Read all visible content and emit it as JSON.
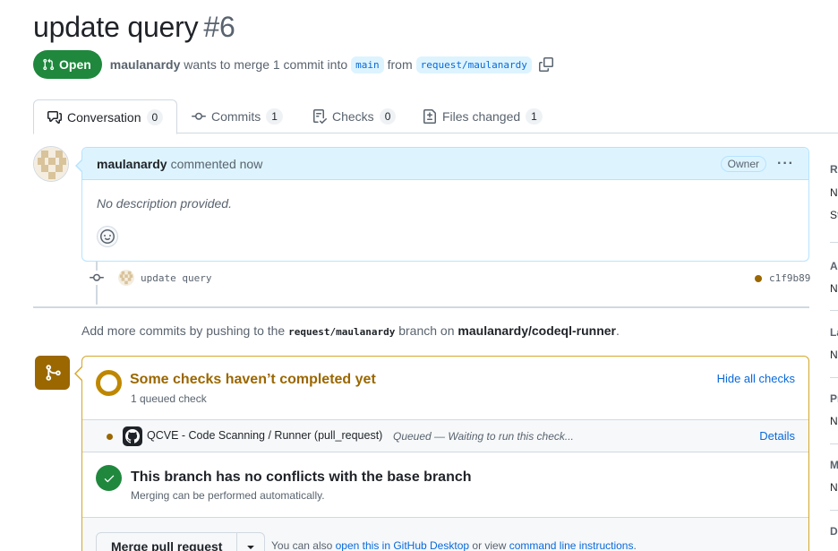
{
  "pr": {
    "title": "update query",
    "number": "#6",
    "state": "Open",
    "author": "maulanardy",
    "merge_text": "wants to merge 1 commit into",
    "base_branch": "main",
    "from_text": "from",
    "head_branch": "request/maulanardy"
  },
  "tabs": [
    {
      "label": "Conversation",
      "count": "0",
      "icon": "comment-discussion-icon",
      "active": true
    },
    {
      "label": "Commits",
      "count": "1",
      "icon": "git-commit-icon",
      "active": false
    },
    {
      "label": "Checks",
      "count": "0",
      "icon": "checklist-icon",
      "active": false
    },
    {
      "label": "Files changed",
      "count": "1",
      "icon": "file-diff-icon",
      "active": false
    }
  ],
  "comment": {
    "author": "maulanardy",
    "action": "commented now",
    "role_badge": "Owner",
    "body": "No description provided."
  },
  "commit": {
    "message": "update query",
    "sha": "c1f9b89",
    "status_color": "#9a6700"
  },
  "push_hint": {
    "prefix": "Add more commits by pushing to the",
    "branch": "request/maulanardy",
    "middle": "branch on",
    "repo": "maulanardy/codeql-runner",
    "suffix": "."
  },
  "merge_box": {
    "checks_title": "Some checks haven’t completed yet",
    "checks_sub": "1 queued check",
    "hide_checks": "Hide all checks",
    "check": {
      "name": "QCVE - Code Scanning / Runner (pull_request)",
      "status": "Queued — Waiting to run this check...",
      "details": "Details"
    },
    "conflict_title": "This branch has no conflicts with the base branch",
    "conflict_sub": "Merging can be performed automatically.",
    "merge_button": "Merge pull request",
    "also_prefix": "You can also",
    "also_link1": "open this in GitHub Desktop",
    "also_middle": "or view",
    "also_link2": "command line instructions",
    "also_suffix": "."
  },
  "sidebar": {
    "items": [
      "Re",
      "N",
      "St",
      "As",
      "N",
      "La",
      "N",
      "Pr",
      "N",
      "M",
      "N",
      "D"
    ]
  },
  "colors": {
    "open_green": "#1f883d",
    "pending_yellow": "#bf8700",
    "link_blue": "#0969da",
    "comment_header_bg": "#ddf4ff"
  }
}
